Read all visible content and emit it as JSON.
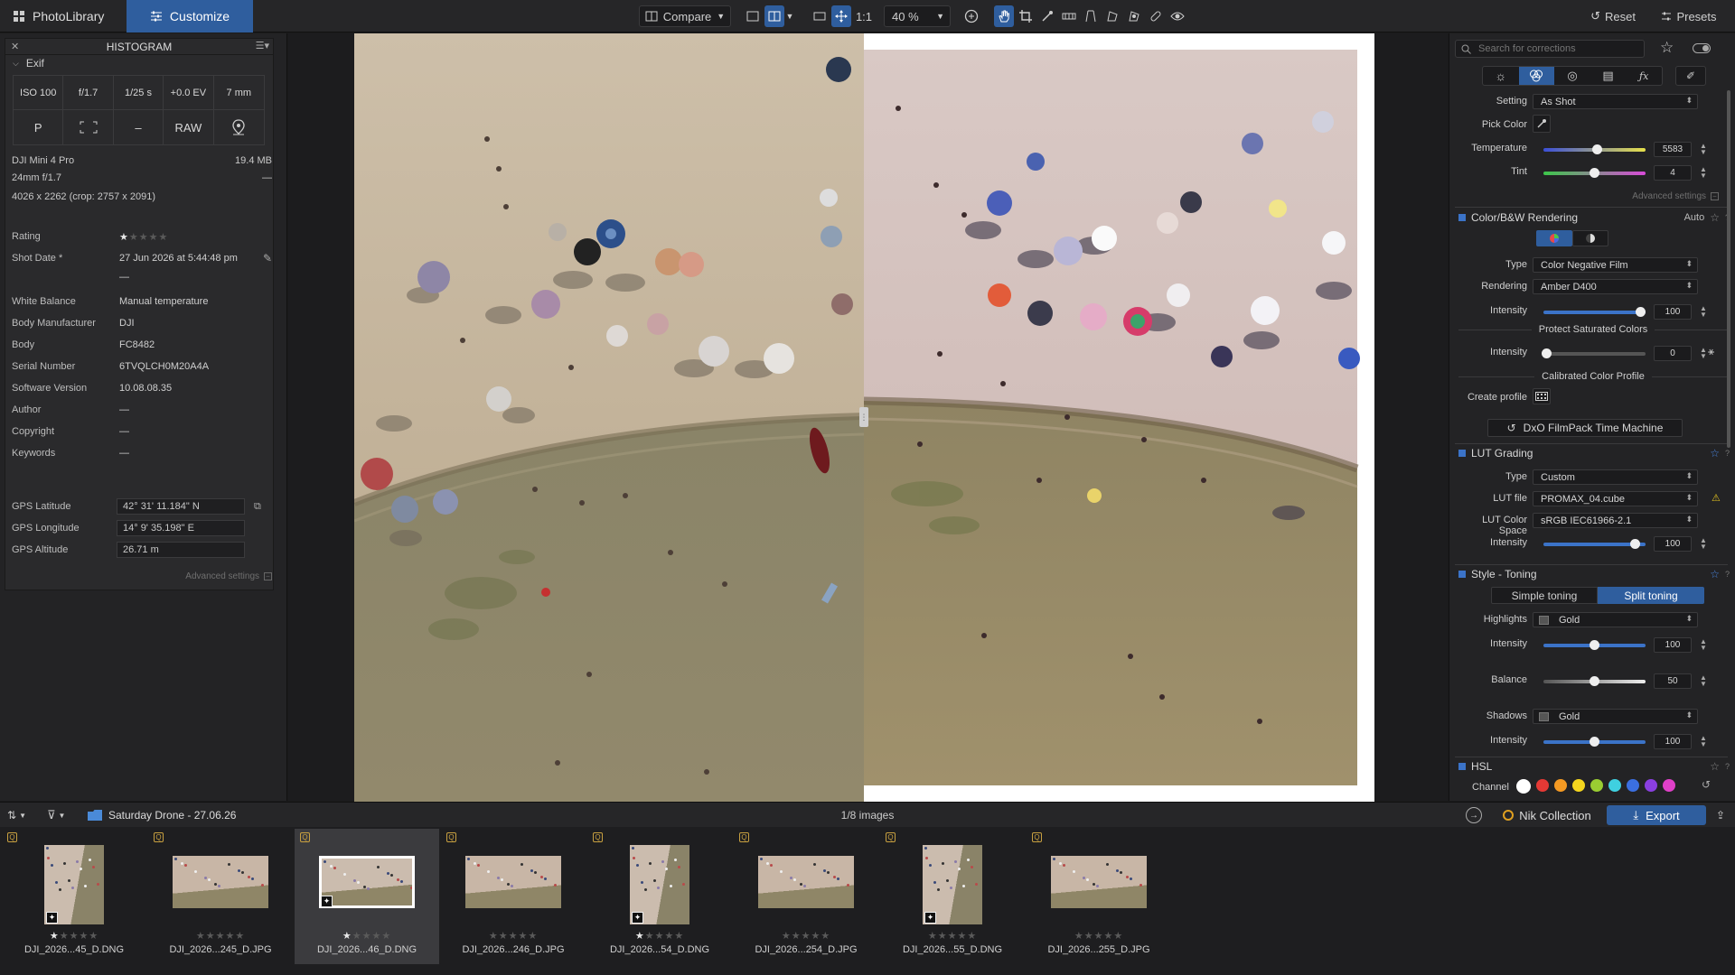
{
  "tabs": {
    "photolibrary": "PhotoLibrary",
    "customize": "Customize"
  },
  "toolbar": {
    "compare": "Compare",
    "ratio": "1:1",
    "zoom": "40 %",
    "reset": "Reset",
    "presets": "Presets"
  },
  "histogram": {
    "title": "HISTOGRAM",
    "exif_label": "Exif"
  },
  "exif_cells": [
    "ISO 100",
    "f/1.7",
    "1/25 s",
    "+0.0 EV",
    "7 mm",
    "P",
    "",
    "–",
    "RAW",
    ""
  ],
  "camera": {
    "model": "DJI Mini 4 Pro",
    "size": "19.4 MB",
    "lens": "24mm f/1.7",
    "lens_extra": "—",
    "dims": "4026 x 2262  (crop: 2757 x 2091)"
  },
  "info": [
    {
      "label": "Rating",
      "value": ""
    },
    {
      "label": "Shot Date *",
      "value": "27 Jun 2026 at 5:44:48 pm"
    },
    {
      "label": "",
      "value": "—"
    },
    {
      "label": "White Balance",
      "value": "Manual temperature"
    },
    {
      "label": "Body Manufacturer",
      "value": "DJI"
    },
    {
      "label": "Body",
      "value": "FC8482"
    },
    {
      "label": "Serial Number",
      "value": "6TVQLCH0M20A4A"
    },
    {
      "label": "Software Version",
      "value": "10.08.08.35"
    },
    {
      "label": "Author",
      "value": "—"
    },
    {
      "label": "Copyright",
      "value": "—"
    },
    {
      "label": "Keywords",
      "value": "—"
    }
  ],
  "rating_stars": "★★★★★",
  "rating_value": 1,
  "gps": [
    {
      "label": "GPS Latitude",
      "value": "42° 31' 11.184\" N"
    },
    {
      "label": "GPS Longitude",
      "value": "14° 9' 35.198\" E"
    },
    {
      "label": "GPS Altitude",
      "value": "26.71 m"
    }
  ],
  "left_advanced": "Advanced settings",
  "right": {
    "search_placeholder": "Search for corrections",
    "wb": {
      "setting_label": "Setting",
      "setting_value": "As Shot",
      "pick_color": "Pick Color",
      "temperature_label": "Temperature",
      "temperature_value": "5583",
      "tint_label": "Tint",
      "tint_value": "4",
      "advanced": "Advanced settings"
    },
    "color_bw": {
      "title": "Color/B&W Rendering",
      "auto": "Auto",
      "type_label": "Type",
      "type_value": "Color Negative Film",
      "rendering_label": "Rendering",
      "rendering_value": "Amber D400",
      "intensity_label": "Intensity",
      "intensity_value": "100",
      "protect_title": "Protect Saturated Colors",
      "protect_intensity_label": "Intensity",
      "protect_intensity_value": "0",
      "calibrated_title": "Calibrated Color Profile",
      "create_profile": "Create profile",
      "time_machine": "DxO FilmPack Time Machine"
    },
    "lut": {
      "title": "LUT Grading",
      "type_label": "Type",
      "type_value": "Custom",
      "file_label": "LUT file",
      "file_value": "PROMAX_04.cube",
      "space_label": "LUT Color Space",
      "space_value": "sRGB IEC61966-2.1",
      "intensity_label": "Intensity",
      "intensity_value": "100"
    },
    "toning": {
      "title": "Style - Toning",
      "simple": "Simple toning",
      "split": "Split toning",
      "highlights_label": "Highlights",
      "highlights_value": "Gold",
      "h_intensity_label": "Intensity",
      "h_intensity_value": "100",
      "balance_label": "Balance",
      "balance_value": "50",
      "shadows_label": "Shadows",
      "shadows_value": "Gold",
      "s_intensity_label": "Intensity",
      "s_intensity_value": "100"
    },
    "hsl": {
      "title": "HSL",
      "channel_label": "Channel"
    },
    "hsl_colors": [
      "#ffffff",
      "#e53935",
      "#f59a23",
      "#f5d61e",
      "#9acd32",
      "#3fd0e0",
      "#3b6fe0",
      "#8a3fe0",
      "#e040c8"
    ]
  },
  "bottom": {
    "folder": "Saturday Drone - 27.06.26",
    "count": "1/8 images",
    "nik": "Nik Collection",
    "export": "Export"
  },
  "film": [
    {
      "name": "DJI_2026...45_D.DNG",
      "stars": "★★★★★",
      "rating": 1,
      "portrait": true,
      "raw": true
    },
    {
      "name": "DJI_2026...245_D.JPG",
      "stars": "★★★★★",
      "rating": 0,
      "portrait": false,
      "raw": false
    },
    {
      "name": "DJI_2026...46_D.DNG",
      "stars": "★★★★★",
      "rating": 1,
      "portrait": false,
      "raw": true,
      "selected": true
    },
    {
      "name": "DJI_2026...246_D.JPG",
      "stars": "★★★★★",
      "rating": 0,
      "portrait": false,
      "raw": false
    },
    {
      "name": "DJI_2026...54_D.DNG",
      "stars": "★★★★★",
      "rating": 1,
      "portrait": true,
      "raw": true
    },
    {
      "name": "DJI_2026...254_D.JPG",
      "stars": "★★★★★",
      "rating": 0,
      "portrait": false,
      "raw": false
    },
    {
      "name": "DJI_2026...55_D.DNG",
      "stars": "★★★★★",
      "rating": 0,
      "portrait": true,
      "raw": true
    },
    {
      "name": "DJI_2026...255_D.JPG",
      "stars": "★★★★★",
      "rating": 0,
      "portrait": false,
      "raw": false
    }
  ]
}
